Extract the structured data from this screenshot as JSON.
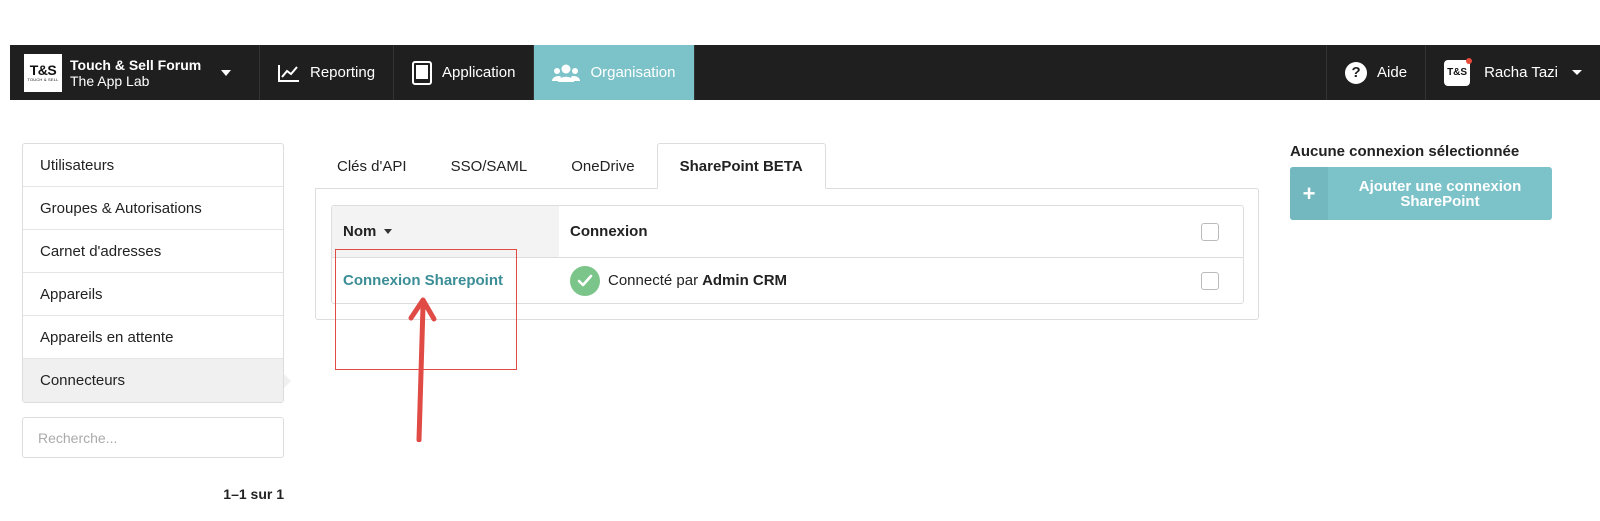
{
  "brand": {
    "logo_text": "T&S",
    "logo_subtext": "TOUCH & SELL",
    "name": "Touch & Sell Forum",
    "subname": "The App Lab"
  },
  "nav": {
    "items": [
      {
        "label": "Reporting",
        "icon": "chart-line-icon"
      },
      {
        "label": "Application",
        "icon": "tablet-icon"
      },
      {
        "label": "Organisation",
        "icon": "users-icon"
      }
    ],
    "help_label": "Aide",
    "user_avatar_text": "T&S",
    "user_name": "Racha Tazi",
    "active_color": "#7cc2c9"
  },
  "sidebar": {
    "items": [
      {
        "label": "Utilisateurs"
      },
      {
        "label": "Groupes & Autorisations"
      },
      {
        "label": "Carnet d'adresses"
      },
      {
        "label": "Appareils"
      },
      {
        "label": "Appareils en attente"
      },
      {
        "label": "Connecteurs"
      }
    ],
    "search_placeholder": "Recherche...",
    "pager": "1–1 sur 1"
  },
  "tabs": [
    {
      "label": "Clés d'API"
    },
    {
      "label": "SSO/SAML"
    },
    {
      "label": "OneDrive"
    },
    {
      "label": "SharePoint BETA"
    }
  ],
  "table": {
    "headers": {
      "nom": "Nom",
      "connexion": "Connexion"
    },
    "rows": [
      {
        "nom": "Connexion Sharepoint",
        "connexion_prefix": "Connecté par",
        "connexion_user": "Admin CRM"
      }
    ]
  },
  "right_panel": {
    "title": "Aucune connexion sélectionnée",
    "add_button_label": "Ajouter une connexion SharePoint",
    "add_button_plus": "+"
  }
}
